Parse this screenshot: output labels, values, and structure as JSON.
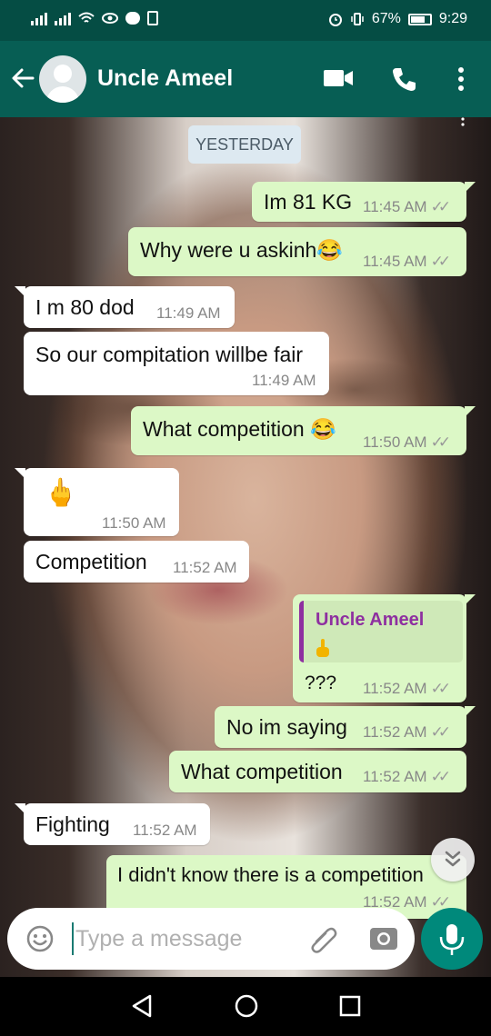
{
  "status_bar": {
    "battery_percent": "67%",
    "time": "9:29"
  },
  "header": {
    "contact_name": "Uncle Ameel"
  },
  "chat": {
    "date_chip": "YESTERDAY",
    "messages": [
      {
        "direction": "out",
        "text": "Im 81 KG",
        "time": "11:45 AM"
      },
      {
        "direction": "out",
        "text": "Why were u askinh😂",
        "time": "11:45 AM"
      },
      {
        "direction": "in",
        "text": "I m 80 dod",
        "time": "11:49 AM"
      },
      {
        "direction": "in",
        "text": "So our compitation willbe fair",
        "time": "11:49 AM"
      },
      {
        "direction": "out",
        "text": "What competition 😂",
        "time": "11:50 AM"
      },
      {
        "direction": "in",
        "text": "🖕",
        "time": "11:50 AM"
      },
      {
        "direction": "in",
        "text": "Competition",
        "time": "11:52 AM"
      },
      {
        "direction": "out",
        "quoted_name": "Uncle Ameel",
        "text": "???",
        "time": "11:52 AM"
      },
      {
        "direction": "out",
        "text": "No im saying",
        "time": "11:52 AM"
      },
      {
        "direction": "out",
        "text": "What competition",
        "time": "11:52 AM"
      },
      {
        "direction": "in",
        "text": "Fighting",
        "time": "11:52 AM"
      },
      {
        "direction": "out",
        "text": "I didn't know there is a competition",
        "time": "11:52 AM"
      }
    ]
  },
  "input": {
    "placeholder": "Type a message"
  },
  "colors": {
    "header": "#075e54",
    "status_bar": "#054d44",
    "outgoing_bubble": "#dcf8c6",
    "incoming_bubble": "#ffffff",
    "accent": "#00897b",
    "quote_name": "#8e2fa0"
  },
  "icons": [
    "back-arrow-icon",
    "video-call-icon",
    "phone-icon",
    "more-options-icon",
    "emoji-icon",
    "attach-icon",
    "camera-icon",
    "mic-icon",
    "scroll-down-icon",
    "nav-back-icon",
    "nav-home-icon",
    "nav-recents-icon"
  ]
}
